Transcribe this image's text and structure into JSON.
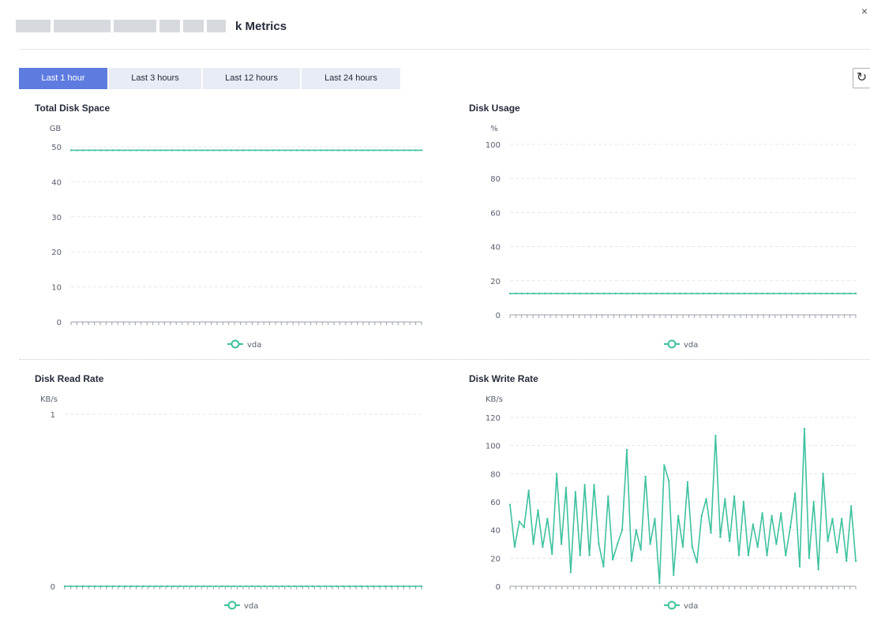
{
  "window": {
    "title": "k Metrics",
    "close_glyph": "×"
  },
  "toolbar": {
    "tabs": [
      {
        "label": "Last 1 hour",
        "active": true
      },
      {
        "label": "Last 3 hours",
        "active": false
      },
      {
        "label": "Last 12 hours",
        "active": false
      },
      {
        "label": "Last 24 hours",
        "active": false
      }
    ],
    "refresh_icon": "refresh-icon"
  },
  "colors": {
    "accent": "#5e7ce0",
    "series": "#3ec1a0",
    "grid": "#e6e8eb",
    "tick_text": "#575d6c"
  },
  "chart_data": [
    {
      "type": "line",
      "title": "Total Disk Space",
      "ylabel": "GB",
      "ylim": [
        0,
        50
      ],
      "yticks": [
        0,
        10,
        20,
        30,
        40,
        50
      ],
      "legend": "bottom-center",
      "grid": true,
      "series": [
        {
          "name": "vda",
          "values": [
            49,
            49,
            49,
            49,
            49,
            49,
            49,
            49,
            49,
            49,
            49,
            49,
            49,
            49,
            49,
            49,
            49,
            49,
            49,
            49,
            49,
            49,
            49,
            49,
            49,
            49,
            49,
            49,
            49,
            49,
            49,
            49,
            49,
            49,
            49,
            49,
            49,
            49,
            49,
            49,
            49,
            49,
            49,
            49,
            49,
            49,
            49,
            49,
            49,
            49,
            49,
            49,
            49,
            49,
            49,
            49,
            49,
            49,
            49,
            49
          ]
        }
      ]
    },
    {
      "type": "line",
      "title": "Disk Usage",
      "ylabel": "%",
      "ylim": [
        0,
        100
      ],
      "yticks": [
        0,
        20,
        40,
        60,
        80,
        100
      ],
      "legend": "bottom-center",
      "grid": true,
      "series": [
        {
          "name": "vda",
          "values": [
            12.5,
            12.5,
            12.5,
            12.5,
            12.5,
            12.5,
            12.5,
            12.5,
            12.5,
            12.5,
            12.5,
            12.5,
            12.5,
            12.5,
            12.5,
            12.5,
            12.5,
            12.5,
            12.5,
            12.5,
            12.5,
            12.5,
            12.5,
            12.5,
            12.5,
            12.5,
            12.5,
            12.5,
            12.5,
            12.5,
            12.5,
            12.5,
            12.5,
            12.5,
            12.5,
            12.5,
            12.5,
            12.5,
            12.5,
            12.5,
            12.5,
            12.5,
            12.5,
            12.5,
            12.5,
            12.5,
            12.5,
            12.5,
            12.5,
            12.5,
            12.5,
            12.5,
            12.5,
            12.5,
            12.5,
            12.5,
            12.5,
            12.5,
            12.5,
            12.5
          ]
        }
      ]
    },
    {
      "type": "line",
      "title": "Disk Read Rate",
      "ylabel": "KB/s",
      "ylim": [
        0,
        1
      ],
      "yticks": [
        0,
        1
      ],
      "legend": "bottom-center",
      "grid": true,
      "series": [
        {
          "name": "vda",
          "values": [
            0,
            0,
            0,
            0,
            0,
            0,
            0,
            0,
            0,
            0,
            0,
            0,
            0,
            0,
            0,
            0,
            0,
            0,
            0,
            0,
            0,
            0,
            0,
            0,
            0,
            0,
            0,
            0,
            0,
            0,
            0,
            0,
            0,
            0,
            0,
            0,
            0,
            0,
            0,
            0,
            0,
            0,
            0,
            0,
            0,
            0,
            0,
            0,
            0,
            0,
            0,
            0,
            0,
            0,
            0,
            0,
            0,
            0,
            0,
            0
          ]
        }
      ]
    },
    {
      "type": "line",
      "title": "Disk Write Rate",
      "ylabel": "KB/s",
      "ylim": [
        0,
        120
      ],
      "yticks": [
        0,
        20,
        40,
        60,
        80,
        100,
        120
      ],
      "legend": "bottom-center",
      "grid": true,
      "series": [
        {
          "name": "vda",
          "values": [
            58,
            28,
            46,
            42,
            68,
            30,
            54,
            28,
            48,
            23,
            80,
            30,
            70,
            10,
            67,
            22,
            72,
            22,
            72,
            30,
            14,
            64,
            19,
            30,
            40,
            97,
            18,
            40,
            26,
            78,
            30,
            48,
            2,
            86,
            75,
            8,
            50,
            28,
            74,
            28,
            17,
            50,
            62,
            38,
            107,
            35,
            62,
            32,
            64,
            22,
            60,
            22,
            44,
            28,
            52,
            22,
            50,
            30,
            52,
            22,
            42,
            66,
            14,
            112,
            20,
            60,
            12,
            80,
            32,
            48,
            24,
            48,
            18,
            57,
            18
          ]
        }
      ]
    }
  ]
}
